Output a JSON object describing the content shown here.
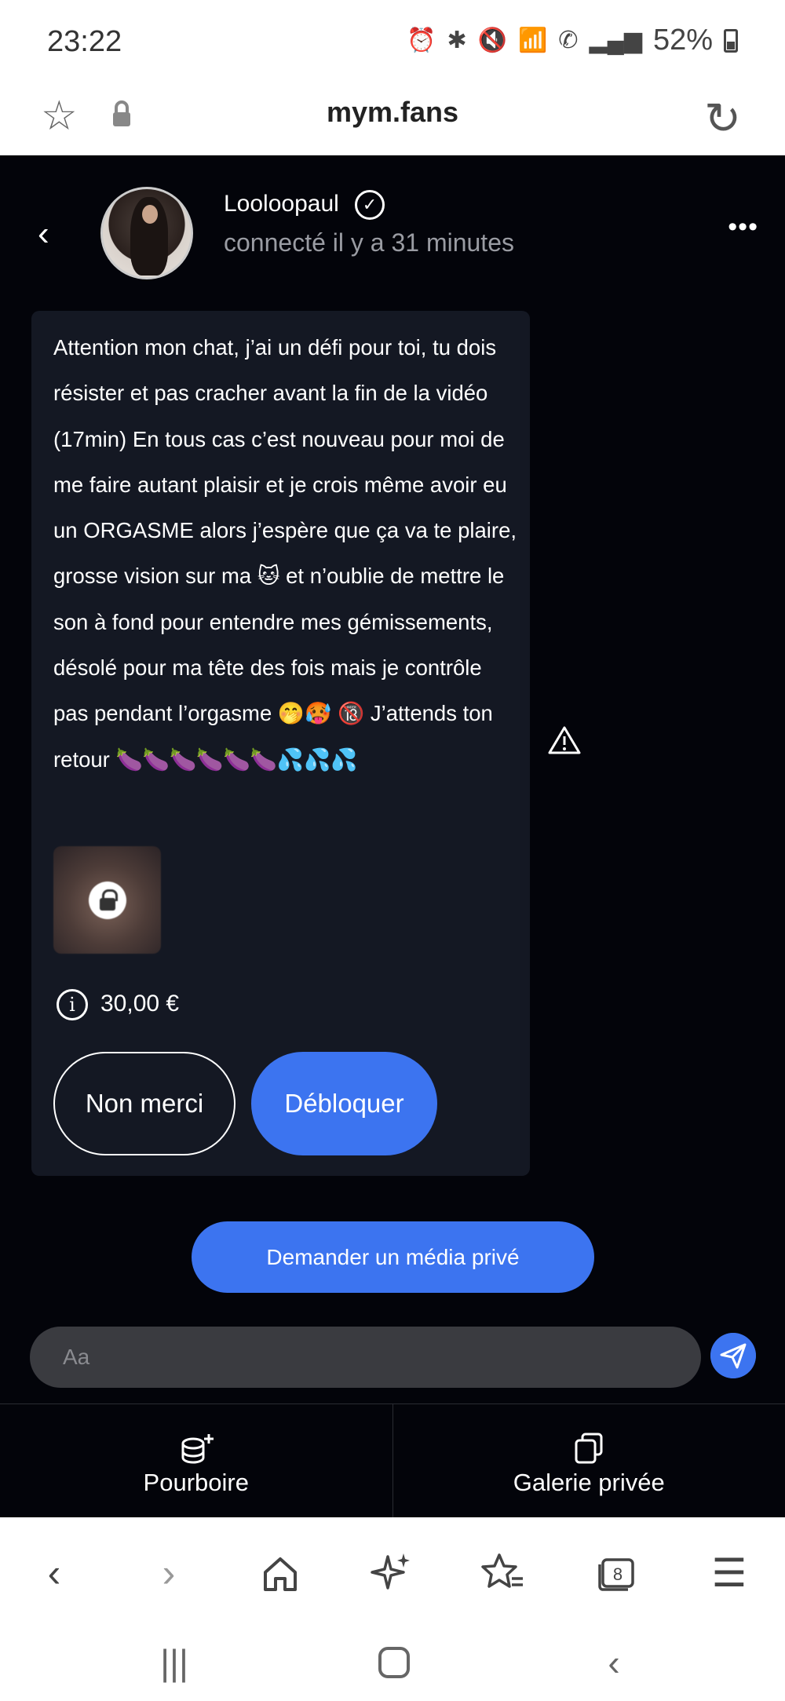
{
  "status_bar": {
    "time": "23:22",
    "battery": "52%"
  },
  "url_bar": {
    "domain": "mym.fans"
  },
  "header": {
    "username": "Looloopaul",
    "presence": "connecté il y a 31 minutes"
  },
  "message": {
    "text": "Attention mon chat, j’ai un défi pour toi, tu dois résister et pas cracher avant la fin de la vidéo (17min) En tous cas c’est nouveau pour moi de me faire autant plaisir et je crois même avoir eu un ORGASME alors j’espère que ça va te plaire, grosse vision sur ma 🐱 et n’oublie de mettre le son à fond pour entendre mes gémissements, désolé pour ma tête des fois mais je contrôle pas pendant l’orgasme 🤭🥵 🔞 J’attends ton retour 🍆🍆🍆🍆🍆🍆💦💦💦",
    "price": "30,00 €",
    "decline_label": "Non merci",
    "unlock_label": "Débloquer"
  },
  "request_button": "Demander un média privé",
  "composer": {
    "placeholder": "Aa"
  },
  "bottom_tabs": [
    {
      "label": "Pourboire",
      "icon": "coins-plus-icon"
    },
    {
      "label": "Galerie privée",
      "icon": "gallery-icon"
    }
  ],
  "browser_nav": {
    "tab_count": "8"
  },
  "colors": {
    "accent": "#3c74f0",
    "app_background": "#03040a",
    "card_background": "#141823",
    "muted_text": "#9a9ca3"
  }
}
